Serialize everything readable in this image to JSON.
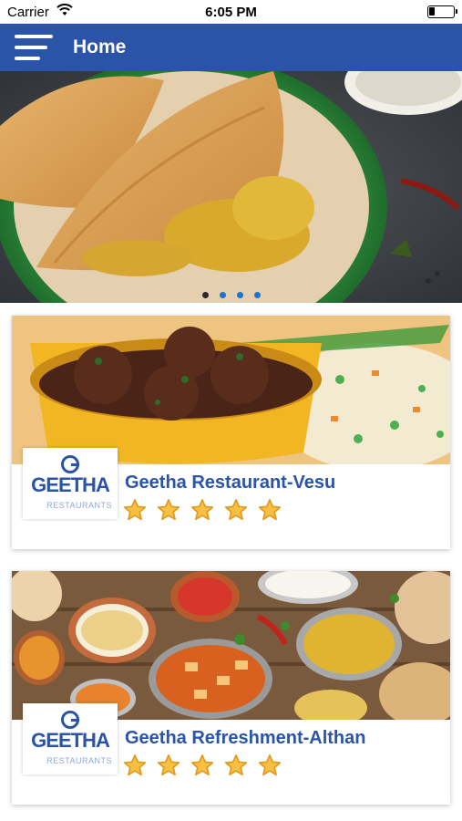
{
  "status_bar": {
    "carrier": "Carrier",
    "time": "6:05 PM"
  },
  "nav": {
    "title": "Home",
    "menu_icon": "hamburger-menu-icon"
  },
  "carousel": {
    "dots": 4,
    "active_index": 1
  },
  "restaurants": [
    {
      "name": "Geetha Restaurant-Vesu",
      "logo_text": "GEETHA",
      "logo_sub": "RESTAURANTS",
      "rating": 5
    },
    {
      "name": "Geetha Refreshment-Althan",
      "logo_text": "GEETHA",
      "logo_sub": "RESTAURANTS",
      "rating": 5
    }
  ],
  "colors": {
    "primary": "#2b54a8",
    "star_fill": "#f7c044",
    "star_stroke": "#e19a1c"
  }
}
